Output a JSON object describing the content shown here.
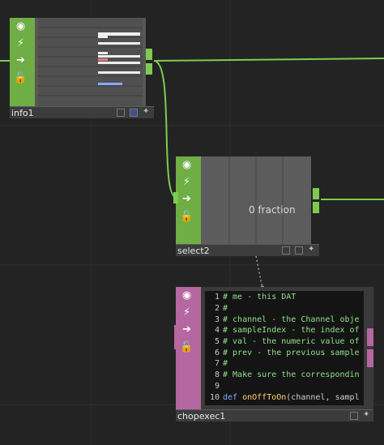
{
  "theme": {
    "bg": "#232323",
    "grid": "#2e2e2e",
    "wire": "#7fcb52",
    "chop_green": "#6fae45",
    "dat_pink": "#b567a2",
    "code_green": "#8fe08a"
  },
  "nodes": {
    "info1": {
      "name": "info1",
      "family": "CHOP",
      "strip_icons": [
        "viewer-toggle-icon",
        "cook-flag-icon",
        "pass-through-icon",
        "lock-icon"
      ]
    },
    "select2": {
      "name": "select2",
      "family": "CHOP",
      "viewer_text": "0 fraction",
      "strip_icons": [
        "viewer-toggle-icon",
        "cook-flag-icon",
        "pass-through-icon",
        "lock-icon"
      ]
    },
    "chopexec1": {
      "name": "chopexec1",
      "family": "DAT",
      "strip_icons": [
        "viewer-toggle-icon",
        "cook-flag-icon",
        "pass-through-icon",
        "lock-icon"
      ],
      "code_lines": [
        {
          "n": "1",
          "text": "# me - this DAT"
        },
        {
          "n": "2",
          "text": "#"
        },
        {
          "n": "3",
          "text": "# channel - the Channel obje"
        },
        {
          "n": "4",
          "text": "# sampleIndex - the index of"
        },
        {
          "n": "5",
          "text": "# val - the numeric value of"
        },
        {
          "n": "6",
          "text": "# prev - the previous sample"
        },
        {
          "n": "7",
          "text": "#"
        },
        {
          "n": "8",
          "text": "# Make sure the correspondin"
        },
        {
          "n": "9",
          "text": ""
        },
        {
          "n": "10",
          "kw": "def ",
          "fn": "onOffToOn",
          "rest": "(channel, sampl"
        }
      ]
    }
  }
}
